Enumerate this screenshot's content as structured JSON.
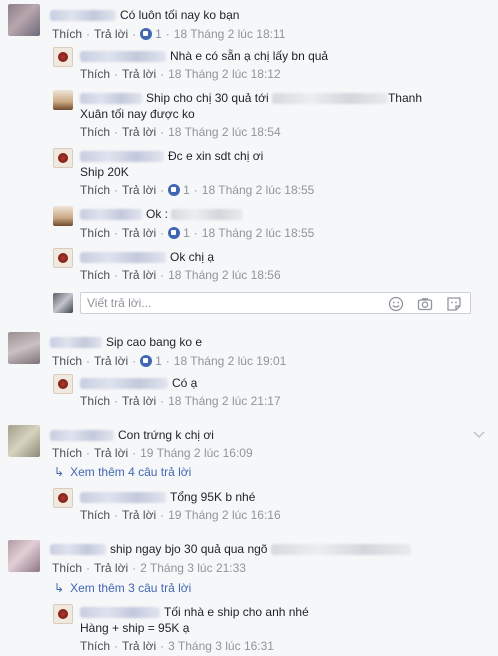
{
  "comments": [
    {
      "id": "c1",
      "text": "Có luôn tối nay ko bạn",
      "reply": "Trả lời",
      "like": "Thích",
      "likes": "1",
      "time": "18 Tháng 2 lúc 18:11"
    },
    {
      "id": "r1",
      "text": "Nhà e có sẵn ạ chị lấy bn quả",
      "reply": "Trả lời",
      "like": "Thích",
      "time": "18 Tháng 2 lúc 18:12"
    },
    {
      "id": "r2",
      "text_a": "Ship cho chị 30 quả tới",
      "text_b": "Thanh",
      "text_c": "Xuân tối nay được ko",
      "reply": "Trả lời",
      "like": "Thích",
      "time": "18 Tháng 2 lúc 18:54"
    },
    {
      "id": "r3",
      "text": "Đc e xin sdt chị ơi",
      "text_2": "Ship 20K",
      "reply": "Trả lời",
      "like": "Thích",
      "likes": "1",
      "time": "18 Tháng 2 lúc 18:55"
    },
    {
      "id": "r4",
      "text": "Ok :",
      "reply": "Trả lời",
      "like": "Thích",
      "likes": "1",
      "time": "18 Tháng 2 lúc 18:55"
    },
    {
      "id": "r5",
      "text": "Ok chị ạ",
      "reply": "Trả lời",
      "like": "Thích",
      "time": "18 Tháng 2 lúc 18:56"
    },
    {
      "id": "c2",
      "text": "Sip cao bang ko e",
      "reply": "Trả lời",
      "like": "Thích",
      "likes": "1",
      "time": "18 Tháng 2 lúc 19:01"
    },
    {
      "id": "r6",
      "text": "Có ạ",
      "reply": "Trả lời",
      "like": "Thích",
      "time": "18 Tháng 2 lúc 21:17"
    },
    {
      "id": "c3",
      "text": "Con trứng k chị ơi",
      "reply": "Trả lời",
      "like": "Thích",
      "time": "19 Tháng 2 lúc 16:09"
    },
    {
      "id": "r7",
      "text": "Tổng 95K b nhé",
      "reply": "Trả lời",
      "like": "Thích",
      "time": "19 Tháng 2 lúc 16:16"
    },
    {
      "id": "c4",
      "text": "ship ngay bjo 30 quả qua ngõ",
      "reply": "Trả lời",
      "like": "Thích",
      "time": "2 Tháng 3 lúc 21:33"
    },
    {
      "id": "r8",
      "text": "Tối nhà e ship cho anh nhé",
      "text_2": "Hàng + ship = 95K ạ",
      "reply": "Trả lời",
      "like": "Thích",
      "time": "3 Tháng 3 lúc 16:31"
    }
  ],
  "more_replies": {
    "c3": "Xem thêm 4 câu trả lời",
    "c4": "Xem thêm 3 câu trả lời"
  },
  "reply_box": {
    "placeholder": "Viết trả lời..."
  },
  "icons": [
    "emoji-icon",
    "camera-icon",
    "sticker-icon",
    "chevron-down-icon",
    "reply-arrow-icon",
    "like-icon"
  ],
  "colors": {
    "link": "#4267b2",
    "meta": "#90949c",
    "text": "#1d2129",
    "background": "#f6f7f9"
  }
}
